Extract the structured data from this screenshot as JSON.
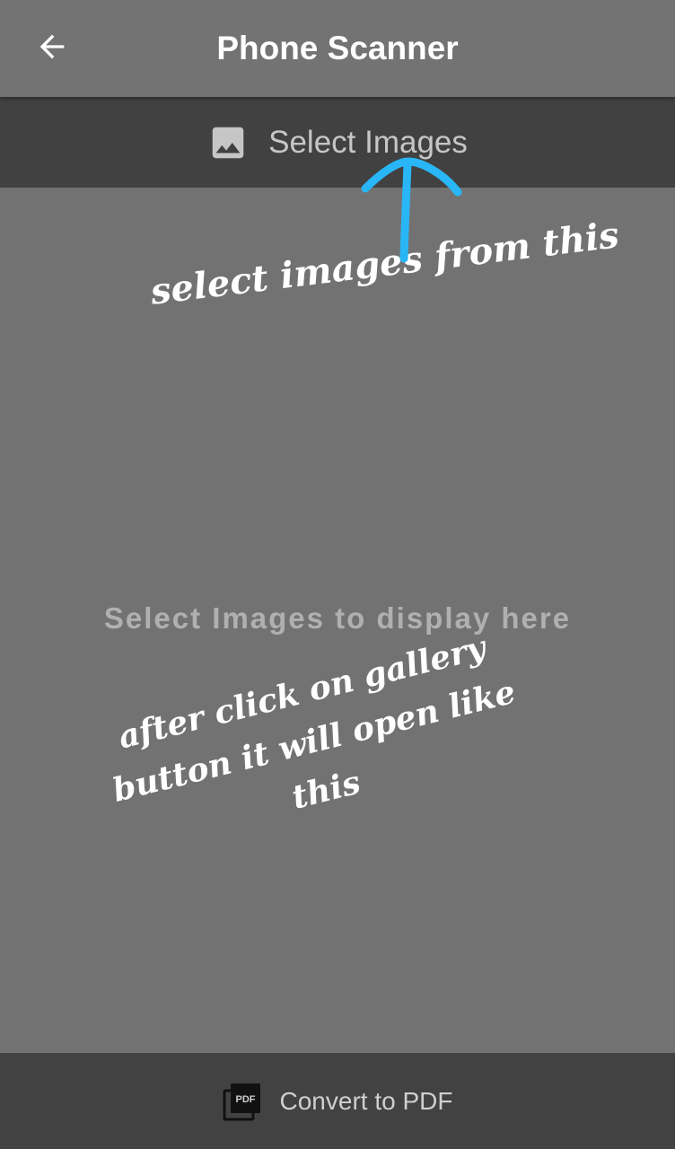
{
  "app_bar": {
    "title": "Phone Scanner",
    "back_icon": "arrow-back-icon"
  },
  "select_bar": {
    "label": "Select Images",
    "icon": "image-icon"
  },
  "main": {
    "empty_text": "Select Images to display here"
  },
  "annotations": {
    "arrow_color": "#29B6F6",
    "note_top": "select images from this",
    "note_bottom": [
      "after click on gallery",
      "button it will open like",
      "this"
    ]
  },
  "bottom_bar": {
    "label": "Convert to PDF",
    "icon": "pdf-icon",
    "icon_text": "PDF"
  }
}
